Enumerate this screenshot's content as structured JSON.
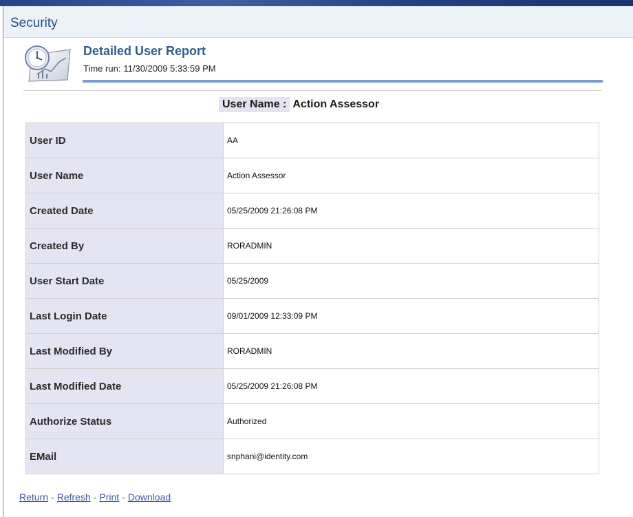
{
  "section": {
    "title": "Security"
  },
  "report": {
    "title": "Detailed User Report",
    "time_run_label": "Time run:",
    "time_run_value": "11/30/2009 5:33:59 PM",
    "icon": "report-clock-chart-icon"
  },
  "heading": {
    "label": "User Name :",
    "value": "Action Assessor"
  },
  "details": [
    {
      "label": "User ID",
      "value": "AA"
    },
    {
      "label": "User Name",
      "value": "Action Assessor"
    },
    {
      "label": "Created Date",
      "value": "05/25/2009 21:26:08 PM"
    },
    {
      "label": "Created By",
      "value": "RORADMIN"
    },
    {
      "label": "User Start Date",
      "value": "05/25/2009"
    },
    {
      "label": "Last Login Date",
      "value": "09/01/2009 12:33:09 PM"
    },
    {
      "label": "Last Modified By",
      "value": "RORADMIN"
    },
    {
      "label": "Last Modified Date",
      "value": "05/25/2009 21:26:08 PM"
    },
    {
      "label": "Authorize Status",
      "value": "Authorized"
    },
    {
      "label": "EMail",
      "value": "snphani@identity.com"
    }
  ],
  "links": [
    {
      "label": "Return"
    },
    {
      "label": "Refresh"
    },
    {
      "label": "Print"
    },
    {
      "label": "Download"
    }
  ],
  "links_separator": "-",
  "colors": {
    "header_bar": "#24448a",
    "section_bg": "#edf1f8",
    "title_blue": "#2f5d8f",
    "label_cell_bg": "#e4e4f2",
    "link": "#3b5998"
  }
}
